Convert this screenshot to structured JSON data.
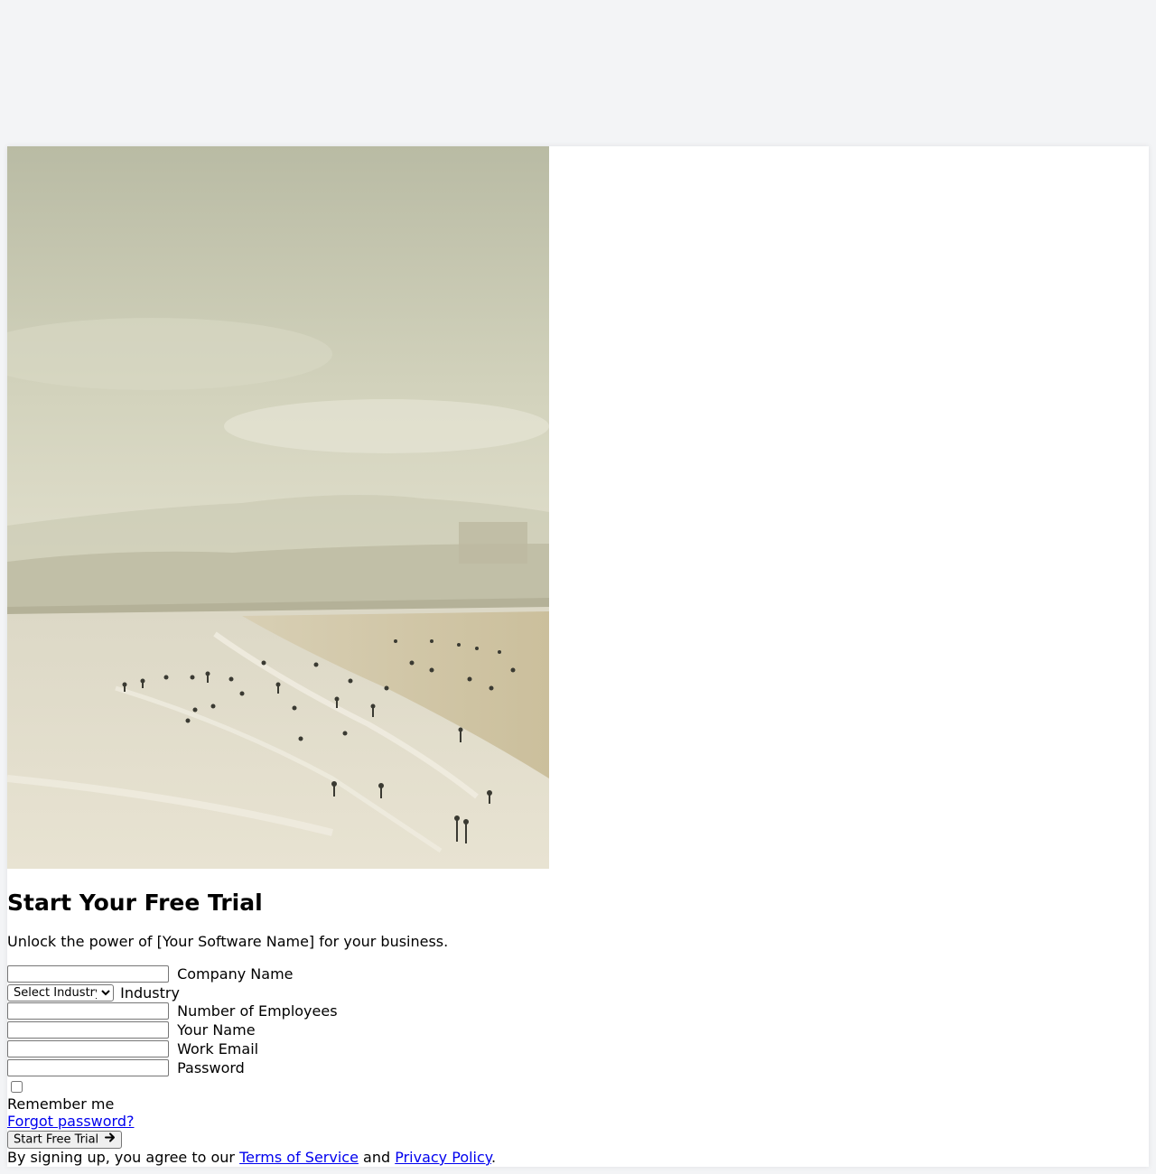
{
  "hero": {
    "image_alt": "Hazy beach with people in the surf"
  },
  "heading": "Start Your Free Trial",
  "subheading": "Unlock the power of [Your Software Name] for your business.",
  "form": {
    "company_name_label": "Company Name",
    "industry_select_value": "Select Industry",
    "industry_label": "Industry",
    "employees_label": "Number of Employees",
    "your_name_label": "Your Name",
    "work_email_label": "Work Email",
    "password_label": "Password",
    "remember_label": "Remember me",
    "forgot_link": "Forgot password?",
    "submit_label": "Start Free Trial",
    "submit_icon": "arrow-right-icon"
  },
  "terms": {
    "prefix": "By signing up, you agree to our ",
    "tos_link": "Terms of Service",
    "and": " and ",
    "privacy_link": "Privacy Policy",
    "suffix": "."
  },
  "colors": {
    "page_bg": "#f3f4f6",
    "card_bg": "#ffffff",
    "link": "#0000ee"
  }
}
